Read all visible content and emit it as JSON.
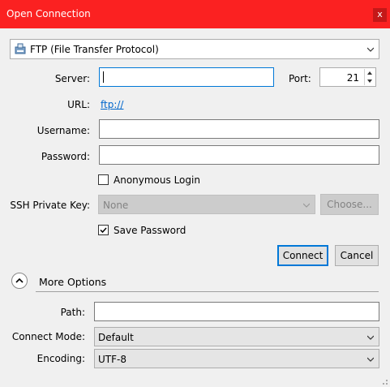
{
  "window": {
    "title": "Open Connection",
    "close_label": "x"
  },
  "protocol": {
    "selected": "FTP (File Transfer Protocol)",
    "icon": "ftp-drive-icon"
  },
  "server": {
    "label": "Server:",
    "value": ""
  },
  "port": {
    "label": "Port:",
    "value": "21"
  },
  "url": {
    "label": "URL:",
    "value": "ftp://"
  },
  "username": {
    "label": "Username:",
    "value": ""
  },
  "password": {
    "label": "Password:",
    "value": ""
  },
  "anonymous": {
    "label": "Anonymous Login",
    "checked": false
  },
  "ssh_key": {
    "label": "SSH Private Key:",
    "selected": "None",
    "choose_label": "Choose..."
  },
  "save_password": {
    "label": "Save Password",
    "checked": true
  },
  "buttons": {
    "connect": "Connect",
    "cancel": "Cancel"
  },
  "more_options": {
    "label": "More Options"
  },
  "path": {
    "label": "Path:",
    "value": ""
  },
  "connect_mode": {
    "label": "Connect Mode:",
    "selected": "Default"
  },
  "encoding": {
    "label": "Encoding:",
    "selected": "UTF-8"
  },
  "colors": {
    "titlebar": "#fb2121",
    "focus": "#0078d7",
    "link": "#0066cc"
  }
}
